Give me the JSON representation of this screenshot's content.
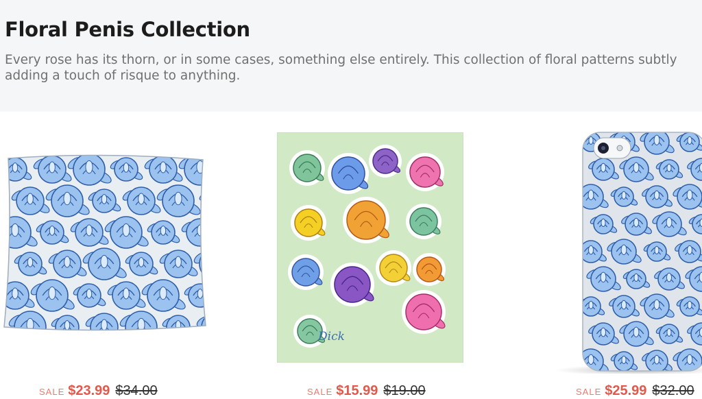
{
  "collection": {
    "title": "Floral Penis Collection",
    "description": "Every rose has its thorn, or in some cases, something else entirely. This collection of floral patterns subtly adding a touch of risque to anything."
  },
  "products": [
    {
      "sale_label": "SALE",
      "sale_price": "$23.99",
      "original_price": "$34.00",
      "image": "pillow"
    },
    {
      "sale_label": "SALE",
      "sale_price": "$15.99",
      "original_price": "$19.00",
      "image": "sticker-sheet"
    },
    {
      "sale_label": "SALE",
      "sale_price": "$25.99",
      "original_price": "$32.00",
      "image": "phone-case"
    }
  ],
  "stickers": [
    {
      "color": "#7fc49a",
      "edge": "#3c7a55"
    },
    {
      "color": "#6c9bea",
      "edge": "#304f9a"
    },
    {
      "color": "#8e63c8",
      "edge": "#4c2c85"
    },
    {
      "color": "#ef73ae",
      "edge": "#a13068"
    },
    {
      "color": "#f4cf24",
      "edge": "#b07d10"
    },
    {
      "color": "#f0a334",
      "edge": "#b55a14"
    },
    {
      "color": "#7cc4a0",
      "edge": "#3d7a60"
    },
    {
      "color": "#6f9fe6",
      "edge": "#34549c"
    },
    {
      "color": "#8a56c4",
      "edge": "#462489"
    },
    {
      "color": "#f3d035",
      "edge": "#b48615"
    },
    {
      "color": "#f29a34",
      "edge": "#b4561a"
    },
    {
      "color": "#ef6fae",
      "edge": "#a42c69"
    },
    {
      "color": "#84c7a0",
      "edge": "#3d7b5a"
    }
  ],
  "sticker_signature": "Dick",
  "colors": {
    "pattern_bg": "#e7ecf1",
    "rose_light": "#9cc3ef",
    "rose_dark": "#2f5fa8",
    "sticker_sheet_bg": "#cfe8c3",
    "sale_red": "#e2584a"
  }
}
